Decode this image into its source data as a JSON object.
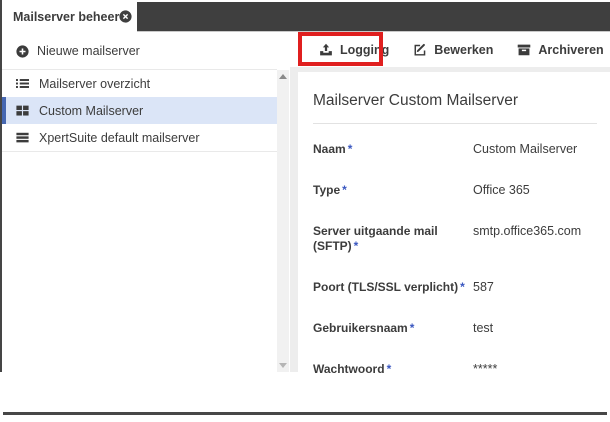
{
  "tab": {
    "title": "Mailserver beheer"
  },
  "sidebar": {
    "new_button": {
      "label": "Nieuwe mailserver",
      "icon": "plus-circle-icon"
    },
    "items": [
      {
        "label": "Mailserver overzicht",
        "icon": "list-icon",
        "selected": false
      },
      {
        "label": "Custom Mailserver",
        "icon": "grid-icon",
        "selected": true
      },
      {
        "label": "XpertSuite default mailserver",
        "icon": "server-icon",
        "selected": false
      }
    ]
  },
  "toolbar": {
    "buttons": [
      {
        "label": "Logging",
        "icon": "upload-icon",
        "annotated": true
      },
      {
        "label": "Bewerken",
        "icon": "edit-icon",
        "annotated": false
      },
      {
        "label": "Archiveren",
        "icon": "archive-icon",
        "annotated": false
      }
    ]
  },
  "main": {
    "title": "Mailserver Custom Mailserver",
    "required_marker": "*",
    "fields": [
      {
        "label": "Naam",
        "required": true,
        "value": "Custom Mailserver"
      },
      {
        "label": "Type",
        "required": true,
        "value": "Office 365"
      },
      {
        "label": "Server uitgaande mail (SFTP)",
        "required": true,
        "value": "smtp.office365.com"
      },
      {
        "label": "Poort (TLS/SSL verplicht)",
        "required": true,
        "value": "587"
      },
      {
        "label": "Gebruikersnaam",
        "required": true,
        "value": "test"
      },
      {
        "label": "Wachtwoord",
        "required": true,
        "value": "*****"
      }
    ]
  },
  "colors": {
    "dark-bar": "#3f3f3f",
    "text": "#3c3c3c",
    "selected-bg": "#dbe5f7",
    "selected-border": "#4667b1",
    "required": "#3a57c0",
    "annotation": "#e01f1f",
    "panel-border": "#e9e9e9",
    "scroll-track": "#f1f1f1",
    "gap": "#ededed"
  }
}
